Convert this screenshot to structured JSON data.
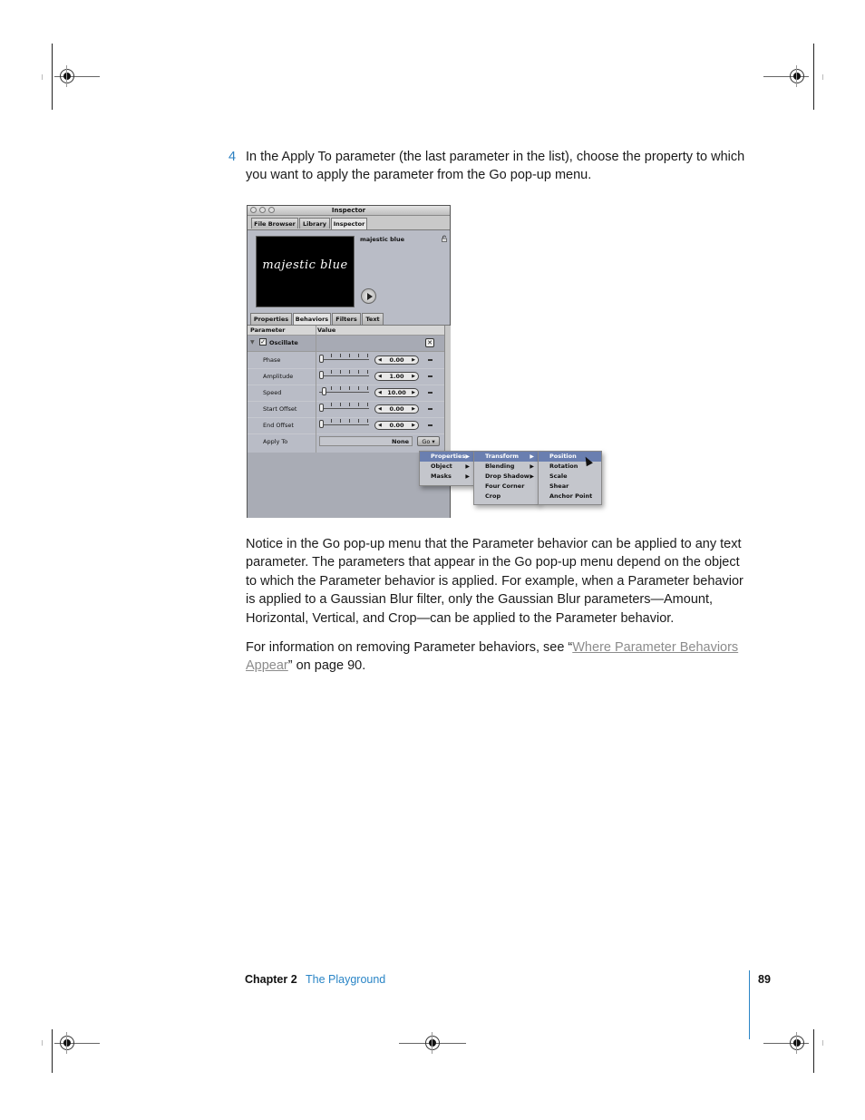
{
  "step": {
    "number": "4",
    "text": "In the Apply To parameter (the last parameter in the list), choose the property to which you want to apply the parameter from the Go pop-up menu."
  },
  "inspector": {
    "window_title": "Inspector",
    "top_tabs": [
      {
        "label": "File Browser",
        "active": false
      },
      {
        "label": "Library",
        "active": false
      },
      {
        "label": "Inspector",
        "active": true
      }
    ],
    "preview_text": "majestic blue",
    "object_name": "majestic blue",
    "sub_tabs": [
      {
        "label": "Properties",
        "active": false
      },
      {
        "label": "Behaviors",
        "active": true
      },
      {
        "label": "Filters",
        "active": false
      },
      {
        "label": "Text",
        "active": false
      }
    ],
    "columns": {
      "parameter": "Parameter",
      "value": "Value"
    },
    "behavior_group": {
      "name": "Oscillate",
      "enabled": true
    },
    "parameters": [
      {
        "label": "Phase",
        "value": "0.00"
      },
      {
        "label": "Amplitude",
        "value": "1.00"
      },
      {
        "label": "Speed",
        "value": "10.00"
      },
      {
        "label": "Start Offset",
        "value": "0.00"
      },
      {
        "label": "End Offset",
        "value": "0.00"
      }
    ],
    "apply_to": {
      "label": "Apply To",
      "value": "None",
      "button": "Go"
    }
  },
  "go_menu": {
    "level1": [
      {
        "label": "Properties",
        "submenu": true,
        "selected": true
      },
      {
        "label": "Object",
        "submenu": true,
        "selected": false
      },
      {
        "label": "Masks",
        "submenu": true,
        "selected": false
      }
    ],
    "level2": [
      {
        "label": "Transform",
        "submenu": true,
        "selected": true
      },
      {
        "label": "Blending",
        "submenu": true,
        "selected": false
      },
      {
        "label": "Drop Shadow",
        "submenu": true,
        "selected": false
      },
      {
        "label": "Four Corner",
        "submenu": false,
        "selected": false
      },
      {
        "label": "Crop",
        "submenu": false,
        "selected": false
      }
    ],
    "level3": [
      {
        "label": "Position",
        "selected": true
      },
      {
        "label": "Rotation",
        "selected": false
      },
      {
        "label": "Scale",
        "selected": false
      },
      {
        "label": "Shear",
        "selected": false
      },
      {
        "label": "Anchor Point",
        "selected": false
      }
    ],
    "arrow": "▶"
  },
  "paragraph1": "Notice in the Go pop-up menu that the Parameter behavior can be applied to any text parameter. The parameters that appear in the Go pop-up menu depend on the object to which the Parameter behavior is applied. For example, when a Parameter behavior is applied to a Gaussian Blur filter, only the Gaussian Blur parameters—Amount, Horizontal, Vertical, and Crop—can be applied to the Parameter behavior.",
  "paragraph2": {
    "before": "For information on removing Parameter behaviors, see “",
    "link": "Where Parameter Behaviors Appear",
    "after": "” on page 90."
  },
  "footer": {
    "chapter": "Chapter 2",
    "title": "The Playground",
    "page": "89"
  },
  "colors": {
    "accent_blue": "#2a85c6",
    "menu_highlight": "#6a7fb0",
    "link_gray": "#8c8c8c"
  }
}
